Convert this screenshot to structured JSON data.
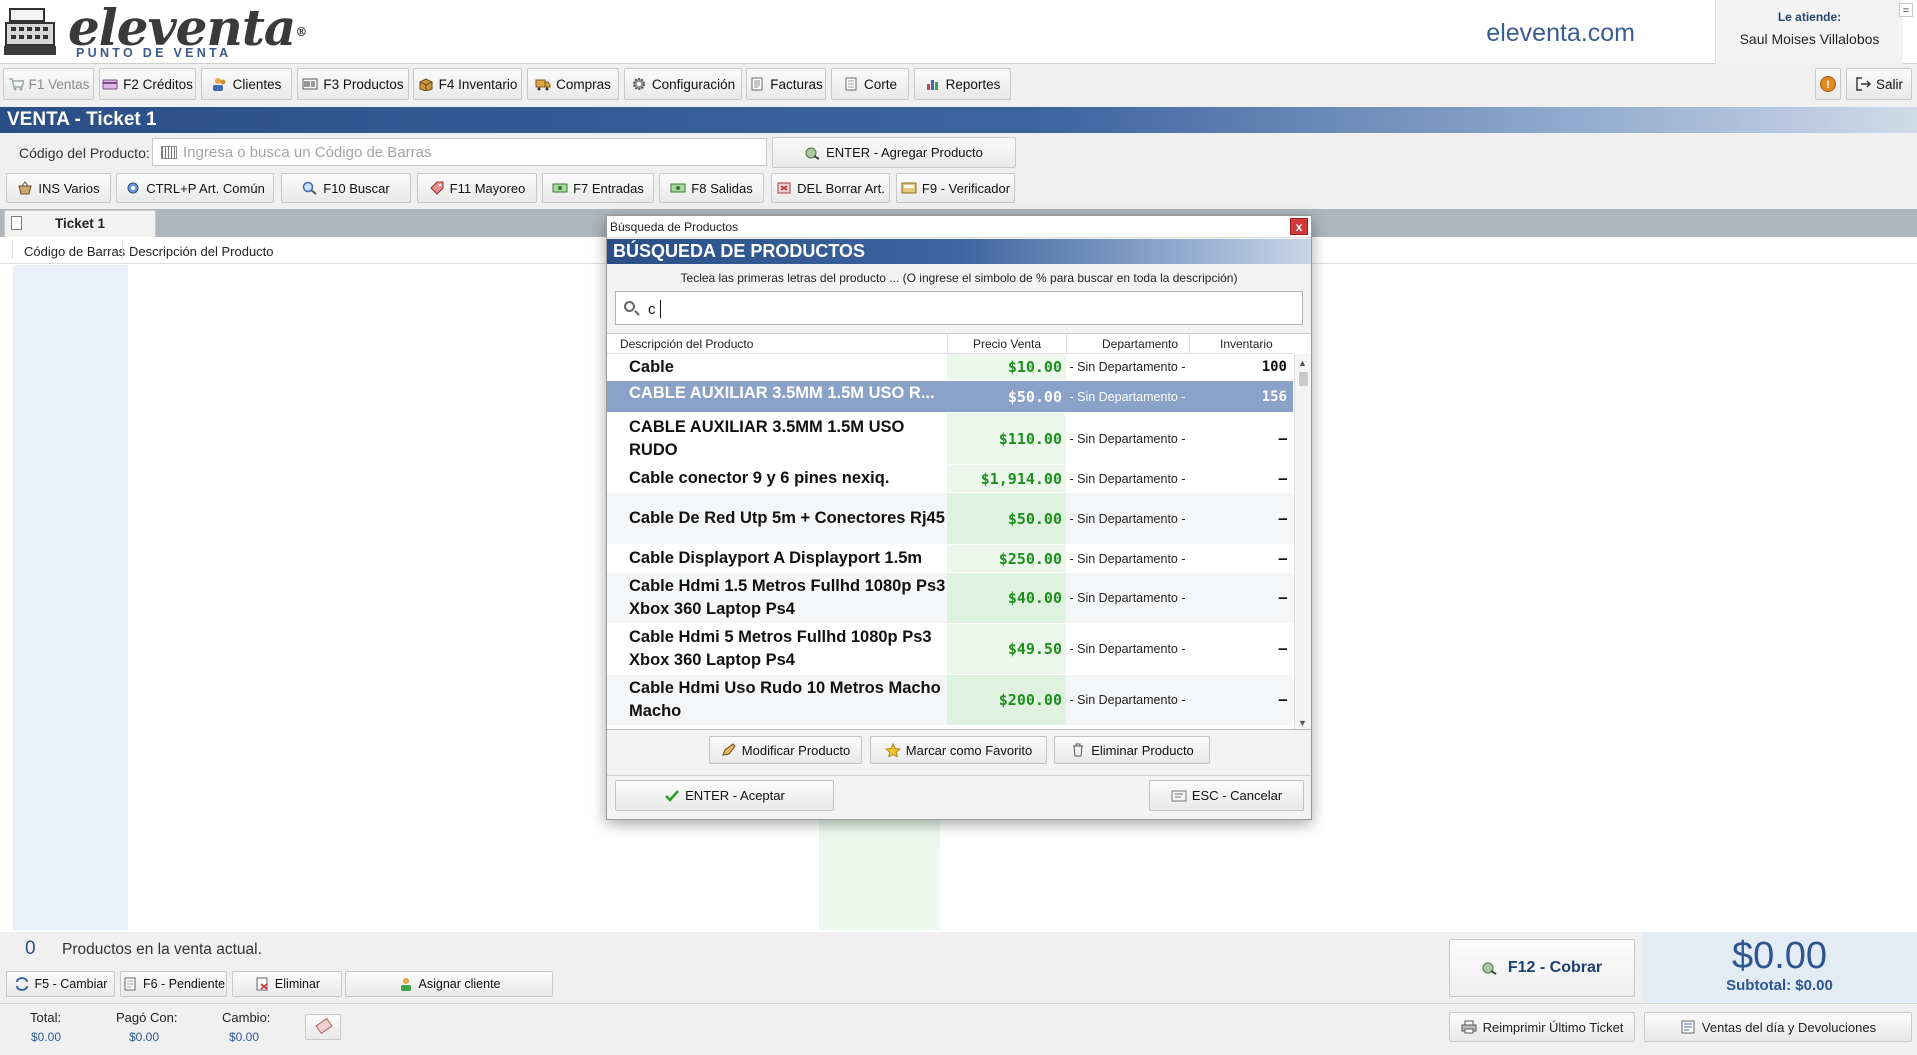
{
  "header": {
    "logo_text": "eleventa",
    "logo_sub": "PUNTO DE VENTA",
    "logo_reg": "®",
    "site": "eleventa.com",
    "attendant_label": "Le atiende:",
    "attendant_name": "Saul Moises Villalobos",
    "min_glyph": "="
  },
  "toolbar": {
    "items": [
      {
        "label": "F1 Ventas",
        "icon": "cart-icon",
        "disabled": true
      },
      {
        "label": "F2 Créditos",
        "icon": "credit-card-icon"
      },
      {
        "label": "Clientes",
        "icon": "users-icon"
      },
      {
        "label": "F3 Productos",
        "icon": "barcode-icon"
      },
      {
        "label": "F4 Inventario",
        "icon": "box-icon"
      },
      {
        "label": "Compras",
        "icon": "truck-icon"
      },
      {
        "label": "Configuración",
        "icon": "gear-icon"
      },
      {
        "label": "Facturas",
        "icon": "invoice-icon"
      },
      {
        "label": "Corte",
        "icon": "register-icon"
      },
      {
        "label": "Reportes",
        "icon": "bar-chart-icon"
      }
    ],
    "alert_glyph": "!",
    "exit_label": "Salir"
  },
  "venta": {
    "title": "VENTA - Ticket 1",
    "code_label": "Código del Producto:",
    "code_placeholder": "Ingresa o busca un Código de Barras",
    "add_button": "ENTER - Agregar Producto"
  },
  "secondary_toolbar": {
    "items": [
      {
        "label": "INS Varios"
      },
      {
        "label": "CTRL+P Art. Común"
      },
      {
        "label": "F10 Buscar"
      },
      {
        "label": "F11 Mayoreo"
      },
      {
        "label": "F7 Entradas"
      },
      {
        "label": "F8 Salidas"
      },
      {
        "label": "DEL Borrar Art."
      },
      {
        "label": "F9 - Verificador"
      }
    ]
  },
  "ticket": {
    "tab_label": "Ticket 1",
    "col_barcode": "Código de Barras",
    "col_description": "Descripción del Producto"
  },
  "footer": {
    "count": "0",
    "count_label": "Productos en la venta actual.",
    "actions": [
      {
        "label": "F5 - Cambiar"
      },
      {
        "label": "F6 - Pendiente"
      },
      {
        "label": "Eliminar"
      },
      {
        "label": "Asignar cliente"
      }
    ],
    "total_label": "Total:",
    "total_value": "$0.00",
    "paid_label": "Pagó Con:",
    "paid_value": "$0.00",
    "change_label": "Cambio:",
    "change_value": "$0.00",
    "charge_button": "F12 - Cobrar",
    "big_total": "$0.00",
    "subtotal": "Subtotal: $0.00",
    "reprint_button": "Reimprimir Último Ticket",
    "sales_day_button": "Ventas del día y Devoluciones"
  },
  "dialog": {
    "window_title": "Búsqueda de Productos",
    "close_glyph": "x",
    "banner": "BÚSQUEDA DE PRODUCTOS",
    "instructions": "Teclea las primeras letras del producto ... (O ingrese el simbolo de % para buscar en toda la descripción)",
    "search_value": "c",
    "columns": {
      "description": "Descripción del Producto",
      "price": "Precio Venta",
      "department": "Departamento",
      "inventory": "Inventario"
    },
    "rows": [
      {
        "desc": "Cable",
        "price": "$10.00",
        "dept": "- Sin Departamento -",
        "inv": "100"
      },
      {
        "desc": "CABLE AUXILIAR 3.5MM 1.5M USO R...",
        "price": "$50.00",
        "dept": "- Sin Departamento -",
        "inv": "156"
      },
      {
        "desc": "CABLE AUXILIAR 3.5MM 1.5M USO RUDO",
        "price": "$110.00",
        "dept": "- Sin Departamento -",
        "inv": "–"
      },
      {
        "desc": "Cable conector 9 y 6 pines nexiq.",
        "price": "$1,914.00",
        "dept": "- Sin Departamento -",
        "inv": "–"
      },
      {
        "desc": "Cable De Red Utp 5m + Conectores Rj45",
        "price": "$50.00",
        "dept": "- Sin Departamento -",
        "inv": "–"
      },
      {
        "desc": "Cable Displayport A Displayport 1.5m",
        "price": "$250.00",
        "dept": "- Sin Departamento -",
        "inv": "–"
      },
      {
        "desc": "Cable Hdmi 1.5 Metros Fullhd 1080p Ps3 Xbox 360 Laptop Ps4",
        "price": "$40.00",
        "dept": "- Sin Departamento -",
        "inv": "–"
      },
      {
        "desc": "Cable Hdmi 5 Metros Fullhd 1080p Ps3 Xbox 360 Laptop Ps4",
        "price": "$49.50",
        "dept": "- Sin Departamento -",
        "inv": "–"
      },
      {
        "desc": "Cable Hdmi Uso Rudo 10 Metros Macho Macho",
        "price": "$200.00",
        "dept": "- Sin Departamento -",
        "inv": "–"
      }
    ],
    "modify_button": "Modificar Producto",
    "favorite_button": "Marcar como Favorito",
    "delete_button": "Eliminar Producto",
    "accept_button": "ENTER - Aceptar",
    "cancel_button": "ESC - Cancelar"
  },
  "colors": {
    "accent": "#2a4f86",
    "price_green": "#1e8f1e",
    "selected_row": "#8aa2c8"
  }
}
